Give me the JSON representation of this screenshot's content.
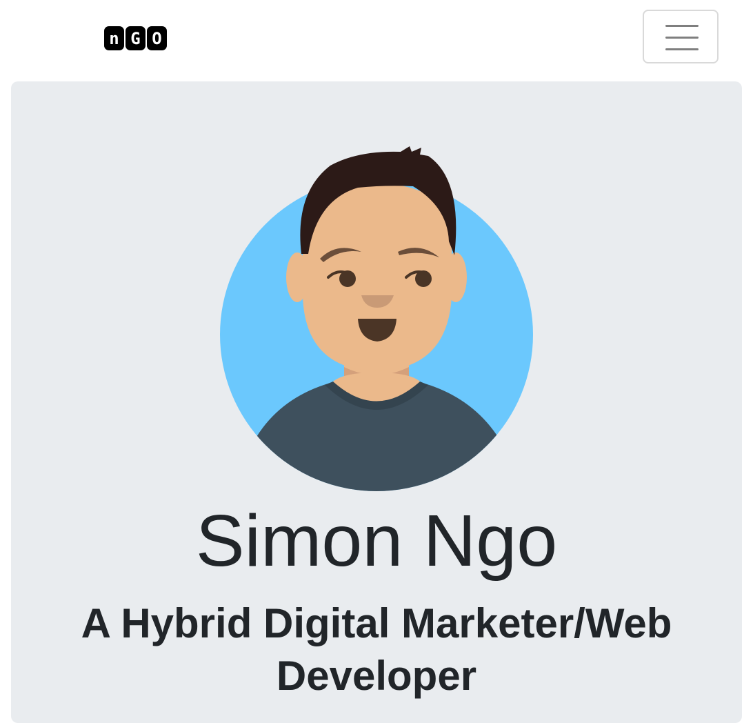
{
  "navbar": {
    "brand_letters": [
      "n",
      "G",
      "O"
    ],
    "menu_icon": "hamburger-menu-icon"
  },
  "hero": {
    "avatar_icon": "cartoon-avatar-icon",
    "name": "Simon Ngo",
    "tagline": "A Hybrid Digital Marketer/Web Developer"
  },
  "colors": {
    "jumbotron_bg": "#e9ecef",
    "avatar_circle": "#6bc8fd",
    "hair": "#2c1a17",
    "skin": "#ebb98b",
    "shirt": "#3e505d",
    "text": "#212529"
  }
}
